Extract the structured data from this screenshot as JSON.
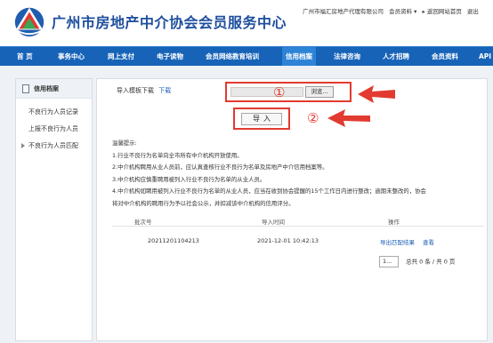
{
  "header": {
    "site_title": "广州市房地产中介协会会员服务中心",
    "company": "广州市福汇房地产代理有限公司",
    "member_menu": "会员资料",
    "home_link": "返回网站首页",
    "logout_link": "退出"
  },
  "nav": [
    "首 页",
    "事务中心",
    "网上支付",
    "电子读物",
    "会员网络教育培训",
    "信用档案",
    "法律咨询",
    "人才招聘",
    "会员资料",
    "API"
  ],
  "sidebar": {
    "title": "信用档案",
    "items": [
      "不良行为人员记录",
      "上报不良行为人员",
      "不良行为人员匹配"
    ]
  },
  "main": {
    "template_label": "导入模板下载",
    "template_link": "下载",
    "browse_label": "浏览...",
    "import_label": "导入",
    "marker1": "①",
    "marker2": "②",
    "tips_title": "温馨提示:",
    "tips": [
      "1.行业不良行为名单向全市所有中介机构开放使用。",
      "2.中介机构聘用从业人员前，应认真查核行业不良行为名单及房地产中介信用档案等。",
      "3.中介机构应慎重聘用被列入行业不良行为名单的从业人员。",
      "4.中介机构如聘用被列入行业不良行为名单的从业人员，应当在收到协会提醒的15个工作日内进行整改；逾期未整改的，协会",
      "将对中介机构的聘用行为予以社会公示，并扣减该中介机构的信用评分。"
    ],
    "table": {
      "headers": [
        "批次号",
        "导入时间",
        "操作"
      ],
      "rows": [
        {
          "batch": "20211201104213",
          "time": "2021-12-01 10:42:13",
          "export": "导出匹配结果",
          "view": "查看"
        }
      ]
    },
    "pager": {
      "input": "1...",
      "summary": "总共 0 条  /  共 0 页"
    }
  },
  "colors": {
    "accent": "#1763b8",
    "annotation": "#e23a30"
  }
}
